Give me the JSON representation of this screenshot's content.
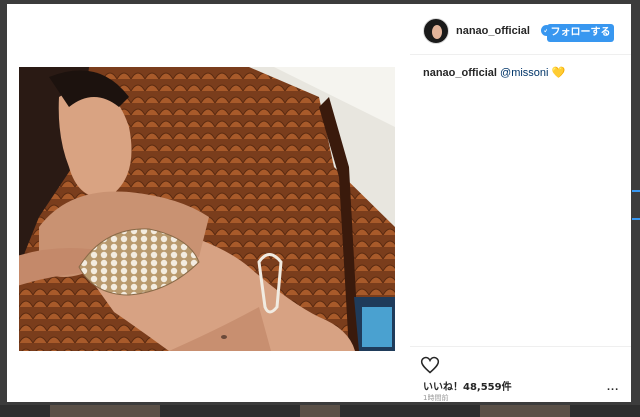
{
  "post": {
    "username": "nanao_official",
    "verified": true,
    "follow_label": "フォローする",
    "caption": {
      "username": "nanao_official",
      "mention": "@missoni",
      "emoji": "💛"
    },
    "likes_text": "いいね！48,559件",
    "timestamp": "1時間前",
    "more_label": "..."
  },
  "colors": {
    "accent": "#3897f0",
    "background_overlay": "#3c3c3c",
    "panel": "#ffffff",
    "text": "#262626",
    "muted": "#999999"
  },
  "icons": [
    "verified-badge-icon",
    "heart-icon",
    "more-options-icon"
  ]
}
